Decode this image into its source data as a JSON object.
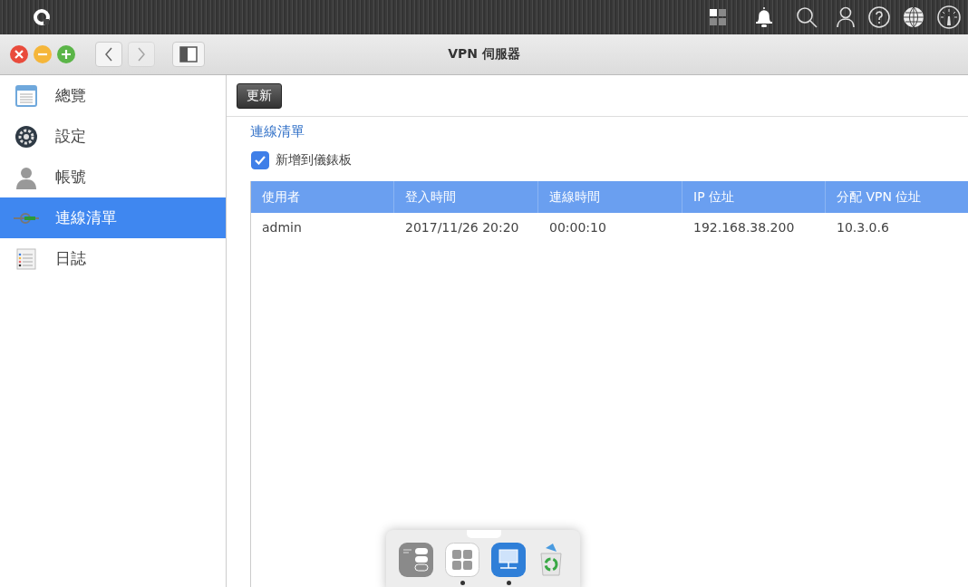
{
  "window": {
    "title": "VPN 伺服器"
  },
  "sidebar": {
    "items": [
      {
        "label": "總覽",
        "kind": "overview",
        "selected": false
      },
      {
        "label": "設定",
        "kind": "settings",
        "selected": false
      },
      {
        "label": "帳號",
        "kind": "account",
        "selected": false
      },
      {
        "label": "連線清單",
        "kind": "connections",
        "selected": true
      },
      {
        "label": "日誌",
        "kind": "log",
        "selected": false
      }
    ]
  },
  "toolbar": {
    "button": "更新"
  },
  "section": {
    "title": "連線清單",
    "checkbox": {
      "label": "新增到儀錶板",
      "checked": true
    }
  },
  "table": {
    "columns": [
      "使用者",
      "登入時間",
      "連線時間",
      "IP 位址",
      "分配 VPN 位址"
    ],
    "rows": [
      [
        "admin",
        "2017/11/26 20:20",
        "00:00:10",
        "192.168.38.200",
        "10.3.0.6"
      ]
    ]
  },
  "dock": {
    "apps": [
      {
        "kind": "switches",
        "running": false
      },
      {
        "kind": "grid",
        "running": true
      },
      {
        "kind": "vpn",
        "running": true
      },
      {
        "kind": "trash",
        "running": false
      }
    ]
  }
}
